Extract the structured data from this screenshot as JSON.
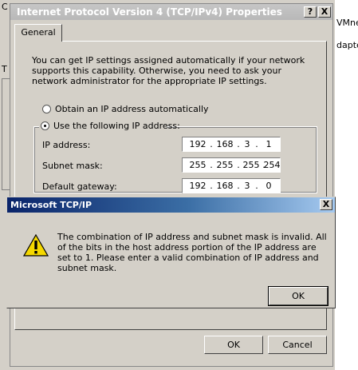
{
  "background": {
    "left_fragments": [
      "C",
      "T"
    ],
    "right_fragments": [
      "VMnet",
      "dapte"
    ]
  },
  "dialog": {
    "title": "Internet Protocol Version 4 (TCP/IPv4) Properties",
    "help_btn": "?",
    "close_btn": "X",
    "tab_general": "General",
    "intro": "You can get IP settings assigned automatically if your network supports this capability. Otherwise, you need to ask your network administrator for the appropriate IP settings.",
    "radio_auto": "Obtain an IP address automatically",
    "radio_manual": "Use the following IP address:",
    "fields": {
      "ip_label": "IP address:",
      "ip": [
        "192",
        "168",
        "3",
        "1"
      ],
      "mask_label": "Subnet mask:",
      "mask": [
        "255",
        "255",
        "255",
        "254"
      ],
      "gw_label": "Default gateway:",
      "gw": [
        "192",
        "168",
        "3",
        "0"
      ],
      "sep": "."
    },
    "ok": "OK",
    "cancel": "Cancel"
  },
  "msgbox": {
    "title": "Microsoft TCP/IP",
    "close_btn": "X",
    "message": "The combination of IP address and subnet mask is invalid. All of the bits in the host address portion of the IP address are set to 1. Please enter a valid combination of IP address and subnet mask.",
    "ok": "OK",
    "icon": "warning-icon"
  }
}
